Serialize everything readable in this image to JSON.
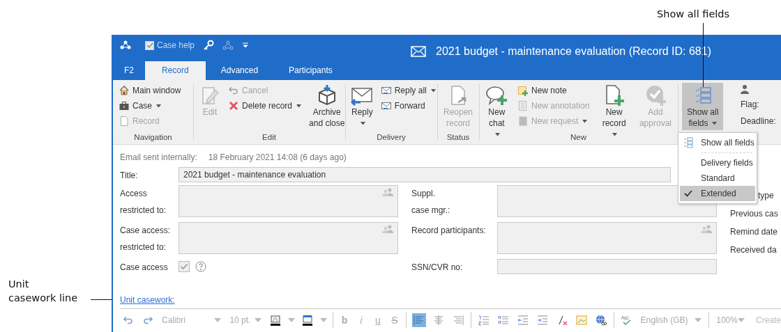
{
  "annotations": [
    {
      "kind": "top",
      "lines": [
        "Show all fields"
      ]
    },
    {
      "kind": "left",
      "lines": [
        "Unit",
        "casework line"
      ]
    }
  ],
  "quick_access": {
    "case_help": {
      "label": "Case help",
      "checked": true
    }
  },
  "window": {
    "title": "2021 budget - maintenance evaluation (Record ID: 681)"
  },
  "tabs": [
    {
      "label": "F2",
      "selected": false
    },
    {
      "label": "Record",
      "selected": true
    },
    {
      "label": "Advanced",
      "selected": false
    },
    {
      "label": "Participants",
      "selected": false
    }
  ],
  "ribbon": {
    "groups": [
      {
        "label": "Navigation",
        "items": [
          {
            "kind": "small",
            "label": "Main window",
            "disabled": false,
            "dropdown": false
          },
          {
            "kind": "small",
            "label": "Case",
            "disabled": false,
            "dropdown": true
          },
          {
            "kind": "small",
            "label": "Record",
            "disabled": true,
            "dropdown": false
          }
        ]
      },
      {
        "label": "Edit",
        "items": [
          {
            "kind": "large",
            "label": "Edit",
            "disabled": true,
            "dropdown": false
          },
          {
            "kind": "small",
            "label": "Cancel",
            "disabled": true,
            "dropdown": false
          },
          {
            "kind": "small",
            "label": "Delete record",
            "disabled": false,
            "dropdown": true
          },
          {
            "kind": "large",
            "label": "Archive and close",
            "disabled": false,
            "dropdown": false
          }
        ]
      },
      {
        "label": "Delivery",
        "items": [
          {
            "kind": "large",
            "label": "Reply",
            "disabled": false,
            "dropdown": true
          },
          {
            "kind": "small",
            "label": "Reply all",
            "disabled": false,
            "dropdown": true
          },
          {
            "kind": "small",
            "label": "Forward",
            "disabled": false,
            "dropdown": false
          }
        ]
      },
      {
        "label": "Status",
        "items": [
          {
            "kind": "large",
            "label": "Reopen record",
            "disabled": true,
            "dropdown": false
          }
        ]
      },
      {
        "label": "New",
        "items": [
          {
            "kind": "large",
            "label": "New chat",
            "disabled": false,
            "dropdown": true
          },
          {
            "kind": "small",
            "label": "New note",
            "disabled": false,
            "dropdown": false
          },
          {
            "kind": "small",
            "label": "New annotation",
            "disabled": true,
            "dropdown": false
          },
          {
            "kind": "small",
            "label": "New request",
            "disabled": true,
            "dropdown": true
          },
          {
            "kind": "large",
            "label": "New record",
            "disabled": false,
            "dropdown": true
          },
          {
            "kind": "large",
            "label": "Add approval",
            "disabled": true,
            "dropdown": false
          }
        ]
      },
      {
        "items": [
          {
            "kind": "large",
            "label": "Show all fields",
            "disabled": false,
            "dropdown": true,
            "expanded": true
          }
        ]
      }
    ],
    "properties": [
      "Flag:",
      "Deadline:"
    ]
  },
  "show_fields_menu": {
    "items": [
      {
        "kind": "command",
        "label": "Show all fields"
      },
      {
        "kind": "separator"
      },
      {
        "kind": "option",
        "label": "Delivery fields",
        "checked": false
      },
      {
        "kind": "option",
        "label": "Standard",
        "checked": false
      },
      {
        "kind": "option",
        "label": "Extended",
        "checked": true
      }
    ]
  },
  "info": {
    "label": "Email sent internally:",
    "value": "18 February 2021 14:08 (6 days ago)"
  },
  "title_field": {
    "label": "Title:",
    "value": "2021 budget - maintenance evaluation"
  },
  "fields": [
    {
      "label_lines": [
        "Access",
        "restricted to:"
      ],
      "kind": "people"
    },
    {
      "label_lines": [
        "Suppl.",
        "case mgr.:"
      ],
      "kind": "area"
    },
    {
      "label_lines": [
        "Case access:",
        "restricted to:"
      ],
      "kind": "people"
    },
    {
      "label_lines": [
        "Record participants:"
      ],
      "kind": "people"
    },
    {
      "label_lines": [
        "Case access"
      ],
      "kind": "checkbox",
      "checked": true
    },
    {
      "label_lines": [
        "SSN/CVR no:"
      ],
      "kind": "text"
    }
  ],
  "side_labels": [
    "type",
    "Previous cas",
    "Remind date",
    "Received da"
  ],
  "unit_casework": {
    "label": "Unit casework:"
  },
  "editor_toolbar": {
    "font": "Calibri",
    "size": "10 pt.",
    "format_buttons": [
      {
        "glyph": "b"
      },
      {
        "glyph": "i"
      },
      {
        "glyph": "u"
      },
      {
        "glyph": "S"
      }
    ],
    "alignments": [
      {
        "selected": true
      },
      {
        "selected": false
      },
      {
        "selected": false
      }
    ],
    "language": "English (GB)",
    "zoom": "100%",
    "create": "Create"
  }
}
